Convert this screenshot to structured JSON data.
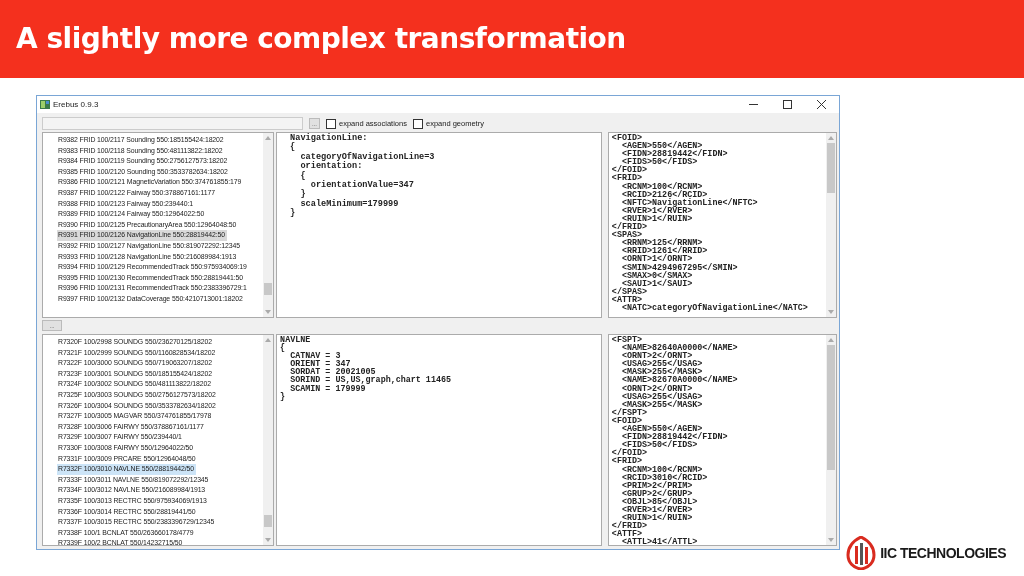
{
  "slide": {
    "title": "A slightly more complex transformation"
  },
  "window": {
    "title": "Erebus 0.9.3"
  },
  "toolbar": {
    "browse_button": "...",
    "checkboxes": [
      {
        "label": "expand associations",
        "checked": false
      },
      {
        "label": "expand geometry",
        "checked": false
      }
    ]
  },
  "panes": [
    {
      "list": [
        {
          "text": "R9382 FRID  100/2117 Sounding 550:185155424:18202",
          "selected": false
        },
        {
          "text": "R9383 FRID  100/2118 Sounding 550:481113822:18202",
          "selected": false
        },
        {
          "text": "R9384 FRID  100/2119 Sounding 550:2756127573:18202",
          "selected": false
        },
        {
          "text": "R9385 FRID  100/2120 Sounding 550:3533782634:18202",
          "selected": false
        },
        {
          "text": "R9386 FRID  100/2121 MagneticVariation 550:374761855:179",
          "selected": false
        },
        {
          "text": "R9387 FRID  100/2122 Fairway 550:378867161:1177",
          "selected": false
        },
        {
          "text": "R9388 FRID  100/2123 Fairway 550:239440:1",
          "selected": false
        },
        {
          "text": "R9389 FRID  100/2124 Fairway 550:12964022:50",
          "selected": false
        },
        {
          "text": "R9390 FRID  100/2125 PrecautionaryArea 550:12964048:50",
          "selected": false
        },
        {
          "text": "R9391 FRID  100/2126 NavigationLine 550:28819442:50",
          "selected": true
        },
        {
          "text": "R9392 FRID  100/2127 NavigationLine 550:819072292:12345",
          "selected": false
        },
        {
          "text": "R9393 FRID  100/2128 NavigationLine 550:216089984:1913",
          "selected": false
        },
        {
          "text": "R9394 FRID  100/2129 RecommendedTrack 550:975934069:19",
          "selected": false
        },
        {
          "text": "R9395 FRID  100/2130 RecommendedTrack 550:28819441:50",
          "selected": false
        },
        {
          "text": "R9396 FRID  100/2131 RecommendedTrack 550:2383396729:1",
          "selected": false
        },
        {
          "text": "R9397 FRID  100/2132 DataCoverage 550:4210713001:18202",
          "selected": false
        }
      ],
      "object_text": [
        "NavigationLine:",
        "{",
        "  categoryOfNavigationLine=3",
        "  orientation:",
        "  {",
        "    orientationValue=347",
        "  }",
        "  scaleMinimum=179999",
        "}"
      ],
      "record_text": [
        "<FOID>",
        "  <AGEN>550</AGEN>",
        "  <FIDN>28819442</FIDN>",
        "  <FIDS>50</FIDS>",
        "</FOID>",
        "<FRID>",
        "  <RCNM>100</RCNM>",
        "  <RCID>2126</RCID>",
        "  <NFTC>NavigationLine</NFTC>",
        "  <RVER>1</RVER>",
        "  <RUIN>1</RUIN>",
        "</FRID>",
        "<SPAS>",
        "  <RRNM>125</RRNM>",
        "  <RRID>1261</RRID>",
        "  <ORNT>1</ORNT>",
        "  <SMIN>4294967295</SMIN>",
        "  <SMAX>0</SMAX>",
        "  <SAUI>1</SAUI>",
        "</SPAS>",
        "<ATTR>",
        "  <NATC>categoryOfNavigationLine</NATC>"
      ]
    },
    {
      "list": [
        {
          "text": "R7320F 100/2998 SOUNDG 550/236270125/18202",
          "selected": false
        },
        {
          "text": "R7321F 100/2999 SOUNDG 550/1160828534/18202",
          "selected": false
        },
        {
          "text": "R7322F 100/3000 SOUNDG 550/719063207/18202",
          "selected": false
        },
        {
          "text": "R7323F 100/3001 SOUNDG 550/185155424/18202",
          "selected": false
        },
        {
          "text": "R7324F 100/3002 SOUNDG 550/481113822/18202",
          "selected": false
        },
        {
          "text": "R7325F 100/3003 SOUNDG 550/2756127573/18202",
          "selected": false
        },
        {
          "text": "R7326F 100/3004 SOUNDG 550/3533782634/18202",
          "selected": false
        },
        {
          "text": "R7327F 100/3005 MAGVAR 550/374761855/17978",
          "selected": false
        },
        {
          "text": "R7328F 100/3006 FAIRWY 550/378867161/1177",
          "selected": false
        },
        {
          "text": "R7329F 100/3007 FAIRWY 550/239440/1",
          "selected": false
        },
        {
          "text": "R7330F 100/3008 FAIRWY 550/12964022/50",
          "selected": false
        },
        {
          "text": "R7331F 100/3009 PRCARE 550/12964048/50",
          "selected": false
        },
        {
          "text": "R7332F 100/3010 NAVLNE 550/28819442/50",
          "selected": true
        },
        {
          "text": "R7333F 100/3011 NAVLNE 550/819072292/12345",
          "selected": false
        },
        {
          "text": "R7334F 100/3012 NAVLNE 550/216089984/1913",
          "selected": false
        },
        {
          "text": "R7335F 100/3013 RECTRC 550/975934069/1913",
          "selected": false
        },
        {
          "text": "R7336F 100/3014 RECTRC 550/28819441/50",
          "selected": false
        },
        {
          "text": "R7337F 100/3015 RECTRC 550/2383396729/12345",
          "selected": false
        },
        {
          "text": "R7338F 100/1 BCNLAT 550/263660178/4779",
          "selected": false
        },
        {
          "text": "R7339F 100/2 BCNLAT 550/14232715/50",
          "selected": false
        }
      ],
      "object_text": [
        "NAVLNE",
        "{",
        "  CATNAV = 3",
        "  ORIENT = 347",
        "  SORDAT = 20021005",
        "  SORIND = US,US,graph,chart 11465",
        "  SCAMIN = 179999",
        "}"
      ],
      "record_text": [
        "<FSPT>",
        "  <NAME>82640A0000</NAME>",
        "  <ORNT>2</ORNT>",
        "  <USAG>255</USAG>",
        "  <MASK>255</MASK>",
        "  <NAME>82670A0000</NAME>",
        "  <ORNT>2</ORNT>",
        "  <USAG>255</USAG>",
        "  <MASK>255</MASK>",
        "</FSPT>",
        "<FOID>",
        "  <AGEN>550</AGEN>",
        "  <FIDN>28819442</FIDN>",
        "  <FIDS>50</FIDS>",
        "</FOID>",
        "<FRID>",
        "  <RCNM>100</RCNM>",
        "  <RCID>3010</RCID>",
        "  <PRIM>2</PRIM>",
        "  <GRUP>2</GRUP>",
        "  <OBJL>85</OBJL>",
        "  <RVER>1</RVER>",
        "  <RUIN>1</RUIN>",
        "</FRID>",
        "<ATTF>",
        "  <ATTL>41</ATTL>"
      ]
    }
  ],
  "splitter_button": "...",
  "logo": {
    "text": "IIC TECHNOLOGIES"
  }
}
